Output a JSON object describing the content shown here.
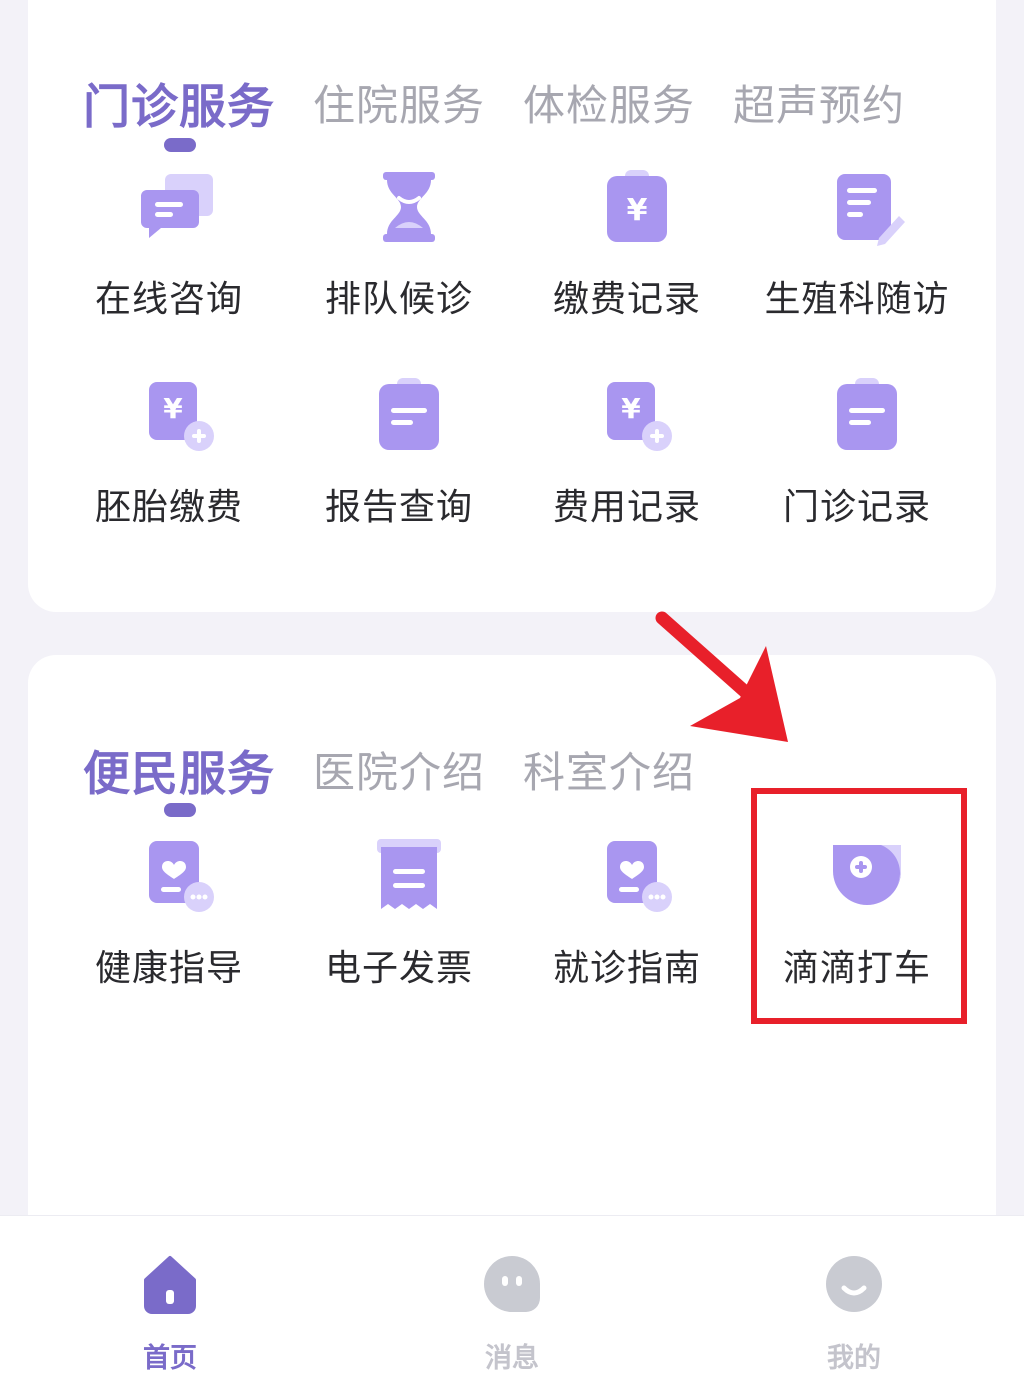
{
  "outpatient_tabs": [
    {
      "label": "门诊服务",
      "active": true
    },
    {
      "label": "住院服务",
      "active": false
    },
    {
      "label": "体检服务",
      "active": false
    },
    {
      "label": "超声预约",
      "active": false
    }
  ],
  "outpatient_grid": [
    {
      "label": "在线咨询",
      "icon": "chat-bubble-icon"
    },
    {
      "label": "排队候诊",
      "icon": "hourglass-icon"
    },
    {
      "label": "缴费记录",
      "icon": "yuan-clipboard-icon"
    },
    {
      "label": "生殖科随访",
      "icon": "notepad-pencil-icon"
    },
    {
      "label": "胚胎缴费",
      "icon": "yuan-card-plus-icon"
    },
    {
      "label": "报告查询",
      "icon": "report-clipboard-icon"
    },
    {
      "label": "费用记录",
      "icon": "yuan-card-plus-icon"
    },
    {
      "label": "门诊记录",
      "icon": "record-clipboard-icon"
    }
  ],
  "service_tabs": [
    {
      "label": "便民服务",
      "active": true
    },
    {
      "label": "医院介绍",
      "active": false
    },
    {
      "label": "科室介绍",
      "active": false
    }
  ],
  "service_grid": [
    {
      "label": "健康指导",
      "icon": "heart-card-icon"
    },
    {
      "label": "电子发票",
      "icon": "invoice-icon"
    },
    {
      "label": "就诊指南",
      "icon": "heart-card-icon"
    },
    {
      "label": "滴滴打车",
      "icon": "medical-shield-icon"
    }
  ],
  "bottom_nav": [
    {
      "label": "首页",
      "icon": "home-icon",
      "active": true
    },
    {
      "label": "消息",
      "icon": "message-icon",
      "active": false
    },
    {
      "label": "我的",
      "icon": "profile-icon",
      "active": false
    }
  ],
  "colors": {
    "accent": "#7a6bc9",
    "icon_fill": "#a996f0",
    "icon_light": "#d9d1fb",
    "inactive": "#a7a7b0",
    "highlight": "#e8202a"
  }
}
